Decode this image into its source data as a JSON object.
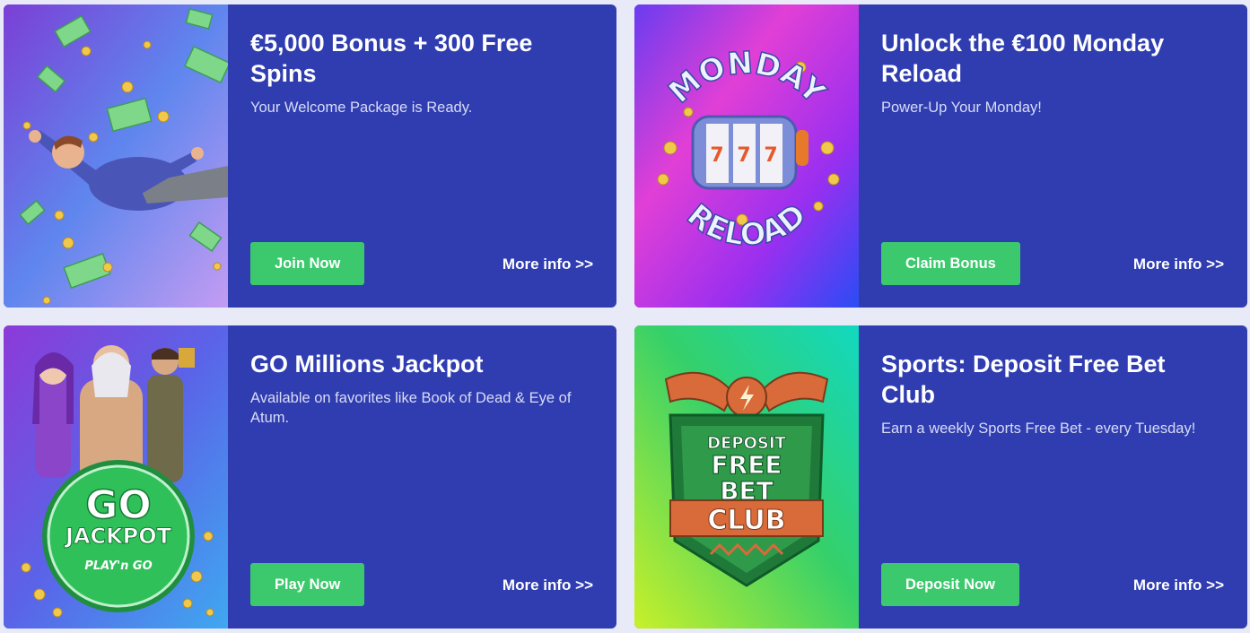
{
  "promotions": [
    {
      "title": "€5,000 Bonus + 300 Free Spins",
      "subtitle": "Your Welcome Package is Ready.",
      "cta_label": "Join Now",
      "more_label": "More info >>",
      "art": "flying-man-money"
    },
    {
      "title": "Unlock the €100 Monday Reload",
      "subtitle": "Power-Up Your Monday!",
      "cta_label": "Claim Bonus",
      "more_label": "More info >>",
      "art": "monday-reload-slot",
      "art_text": {
        "top": "MONDAY",
        "bottom": "RELOAD"
      }
    },
    {
      "title": "GO Millions Jackpot",
      "subtitle": "Available on favorites like Book of Dead & Eye of Atum.",
      "cta_label": "Play Now",
      "more_label": "More info >>",
      "art": "go-jackpot-characters",
      "art_text": {
        "line1": "GO",
        "line2": "JACKPOT",
        "brand": "PLAY'n GO"
      }
    },
    {
      "title": "Sports: Deposit Free Bet Club",
      "subtitle": "Earn a weekly Sports Free Bet - every Tuesday!",
      "cta_label": "Deposit Now",
      "more_label": "More info >>",
      "art": "deposit-free-bet-shield",
      "art_text": {
        "line1": "DEPOSIT",
        "line2": "FREE",
        "line3": "BET",
        "line4": "CLUB"
      }
    }
  ],
  "colors": {
    "page_bg": "#e9eaf7",
    "card_bg": "#2f3db0",
    "cta_green": "#3cc86d",
    "subtitle": "#d9dcf6"
  }
}
